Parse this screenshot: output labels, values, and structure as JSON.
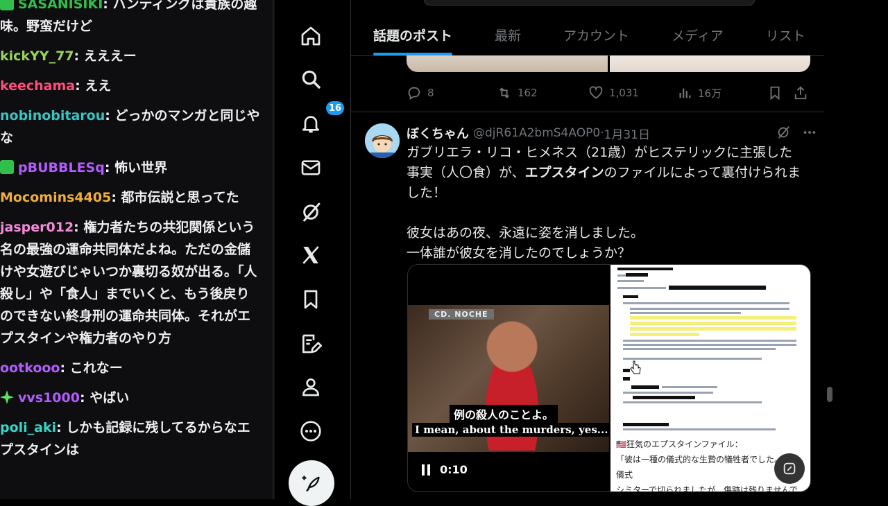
{
  "chat": {
    "messages": [
      {
        "badge": "sub",
        "user": "SASANISIKI",
        "color": "#2fbf4a",
        "text": "ハンティングは貴族の趣味。野蛮だけど"
      },
      {
        "badge": "",
        "user": "kickYY_77",
        "color": "#9ad45b",
        "text": "えええー"
      },
      {
        "badge": "",
        "user": "keechama",
        "color": "#ff4f7a",
        "text": "ええ"
      },
      {
        "badge": "",
        "user": "nobinobitarou",
        "color": "#38c6c4",
        "text": "どっかのマンガと同じやな"
      },
      {
        "badge": "sub",
        "user": "pBUBBLESq",
        "color": "#b35cff",
        "text": "怖い世界"
      },
      {
        "badge": "",
        "user": "Mocomins4405",
        "color": "#f0b03a",
        "text": "都市伝説と思ってた"
      },
      {
        "badge": "",
        "user": "jasper012",
        "color": "#f28ad8",
        "text": "権力者たちの共犯関係という名の最強の運命共同体だよね。ただの金儲けや女遊びじゃいつか裏切る奴が出る。「人殺し」や「食人」までいくと、もう後戻りのできない終身刑の運命共同体。それがエプスタインや権力者のやり方"
      },
      {
        "badge": "",
        "user": "ootkooo",
        "color": "#b35cff",
        "text": "これなー"
      },
      {
        "badge": "star",
        "user": "vvs1000",
        "color": "#b35cff",
        "text": "やばい"
      },
      {
        "badge": "",
        "user": "poli_aki",
        "color": "#38d6c8",
        "text": "しかも記録に残してるからなエプスタインは"
      }
    ]
  },
  "nav": {
    "items": [
      "home-icon",
      "search-icon",
      "notifications-icon",
      "messages-icon",
      "grok-icon",
      "x-premium-icon",
      "bookmarks-icon",
      "articles-icon",
      "profile-icon",
      "more-icon"
    ],
    "notification_count": "16",
    "post_button_icon": "compose-icon"
  },
  "timeline": {
    "tabs": [
      "話題のポスト",
      "最新",
      "アカウント",
      "メディア",
      "リスト"
    ],
    "active_tab": "話題のポスト",
    "accent": "#1d9bf0",
    "previous_post_actions": {
      "replies": "8",
      "reposts": "162",
      "likes": "1,031",
      "views": "16万"
    },
    "tweet": {
      "author_name": "ぼくちゃん",
      "author_handle": "@djR61A2bmS4AOP0",
      "dot": "·",
      "date": "1月31日",
      "body_line1_a": "ガブリエラ・リコ・ヒメネス（21歳）がヒステリックに主張した事実（人〇食）が、",
      "body_line1_bold": "エプスタイン",
      "body_line1_b": "のファイルによって裏付けられました！",
      "body_line2": "彼女はあの夜、永遠に姿を消しました。",
      "body_line3": "一体誰が彼女を消したのでしょうか？",
      "video": {
        "channel_tag": "CD. NOCHE",
        "subtitle_ja": "例の殺人のことよ。",
        "subtitle_en": "I mean, about the murders, yes...",
        "time": "0:10"
      },
      "doc_caption_line1": "🇺🇸狂気のエプスタインファイル：",
      "doc_caption_line2": "「彼は一種の儀式的な生贄の犠牲者でした。その儀式",
      "doc_caption_line3": "シミターで切られましたが、傷跡は残りませんでした。"
    }
  }
}
